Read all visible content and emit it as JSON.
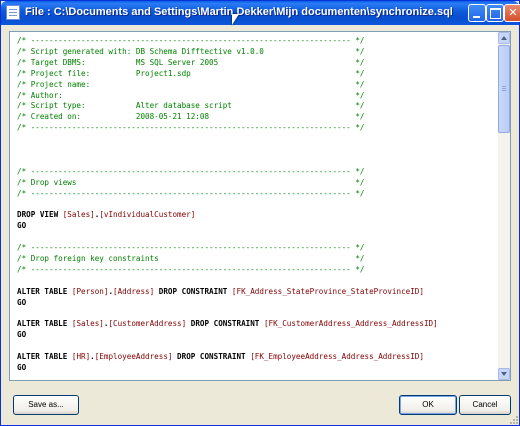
{
  "window": {
    "title": "File : C:\\Documents and Settings\\Martin Dekker\\Mijn documenten\\synchronize.sql",
    "min_glyph": "",
    "max_glyph": "",
    "close_glyph": "✕"
  },
  "code": {
    "lines": [
      [
        {
          "c": "cmt",
          "t": "/* ---------------------------------------------------------------------- */"
        }
      ],
      [
        {
          "c": "cmt",
          "t": "/* Script generated with: DB Schema Difftective v1.0.0                    */"
        }
      ],
      [
        {
          "c": "cmt",
          "t": "/* Target DBMS:           MS SQL Server 2005                              */"
        }
      ],
      [
        {
          "c": "cmt",
          "t": "/* Project file:          Project1.sdp                                    */"
        }
      ],
      [
        {
          "c": "cmt",
          "t": "/* Project name:                                                          */"
        }
      ],
      [
        {
          "c": "cmt",
          "t": "/* Author:                                                                */"
        }
      ],
      [
        {
          "c": "cmt",
          "t": "/* Script type:           Alter database script                           */"
        }
      ],
      [
        {
          "c": "cmt",
          "t": "/* Created on:            2008-05-21 12:08                                */"
        }
      ],
      [
        {
          "c": "cmt",
          "t": "/* ---------------------------------------------------------------------- */"
        }
      ],
      [],
      [],
      [],
      [
        {
          "c": "cmt",
          "t": "/* ---------------------------------------------------------------------- */"
        }
      ],
      [
        {
          "c": "cmt",
          "t": "/* Drop views                                                             */"
        }
      ],
      [
        {
          "c": "cmt",
          "t": "/* ---------------------------------------------------------------------- */"
        }
      ],
      [],
      [
        {
          "c": "kw",
          "t": "DROP VIEW "
        },
        {
          "c": "id",
          "t": "[Sales]"
        },
        {
          "c": "kw",
          "t": "."
        },
        {
          "c": "id",
          "t": "[vIndividualCustomer]"
        }
      ],
      [
        {
          "c": "kw",
          "t": "GO"
        }
      ],
      [],
      [
        {
          "c": "cmt",
          "t": "/* ---------------------------------------------------------------------- */"
        }
      ],
      [
        {
          "c": "cmt",
          "t": "/* Drop foreign key constraints                                           */"
        }
      ],
      [
        {
          "c": "cmt",
          "t": "/* ---------------------------------------------------------------------- */"
        }
      ],
      [],
      [
        {
          "c": "kw",
          "t": "ALTER TABLE "
        },
        {
          "c": "id",
          "t": "[Person]"
        },
        {
          "c": "kw",
          "t": "."
        },
        {
          "c": "id",
          "t": "[Address]"
        },
        {
          "c": "kw",
          "t": " DROP CONSTRAINT "
        },
        {
          "c": "id",
          "t": "[FK_Address_StateProvince_StateProvinceID]"
        }
      ],
      [
        {
          "c": "kw",
          "t": "GO"
        }
      ],
      [],
      [
        {
          "c": "kw",
          "t": "ALTER TABLE "
        },
        {
          "c": "id",
          "t": "[Sales]"
        },
        {
          "c": "kw",
          "t": "."
        },
        {
          "c": "id",
          "t": "[CustomerAddress]"
        },
        {
          "c": "kw",
          "t": " DROP CONSTRAINT "
        },
        {
          "c": "id",
          "t": "[FK_CustomerAddress_Address_AddressID]"
        }
      ],
      [
        {
          "c": "kw",
          "t": "GO"
        }
      ],
      [],
      [
        {
          "c": "kw",
          "t": "ALTER TABLE "
        },
        {
          "c": "id",
          "t": "[HR]"
        },
        {
          "c": "kw",
          "t": "."
        },
        {
          "c": "id",
          "t": "[EmployeeAddress]"
        },
        {
          "c": "kw",
          "t": " DROP CONSTRAINT "
        },
        {
          "c": "id",
          "t": "[FK_EmployeeAddress_Address_AddressID]"
        }
      ],
      [
        {
          "c": "kw",
          "t": "GO"
        }
      ]
    ]
  },
  "buttons": {
    "save_as": "Save as...",
    "ok": "OK",
    "cancel": "Cancel"
  },
  "colors": {
    "comment": "#008000",
    "identifier": "#800000",
    "keyword": "#000000",
    "titlebar": "#0a5fe6"
  }
}
